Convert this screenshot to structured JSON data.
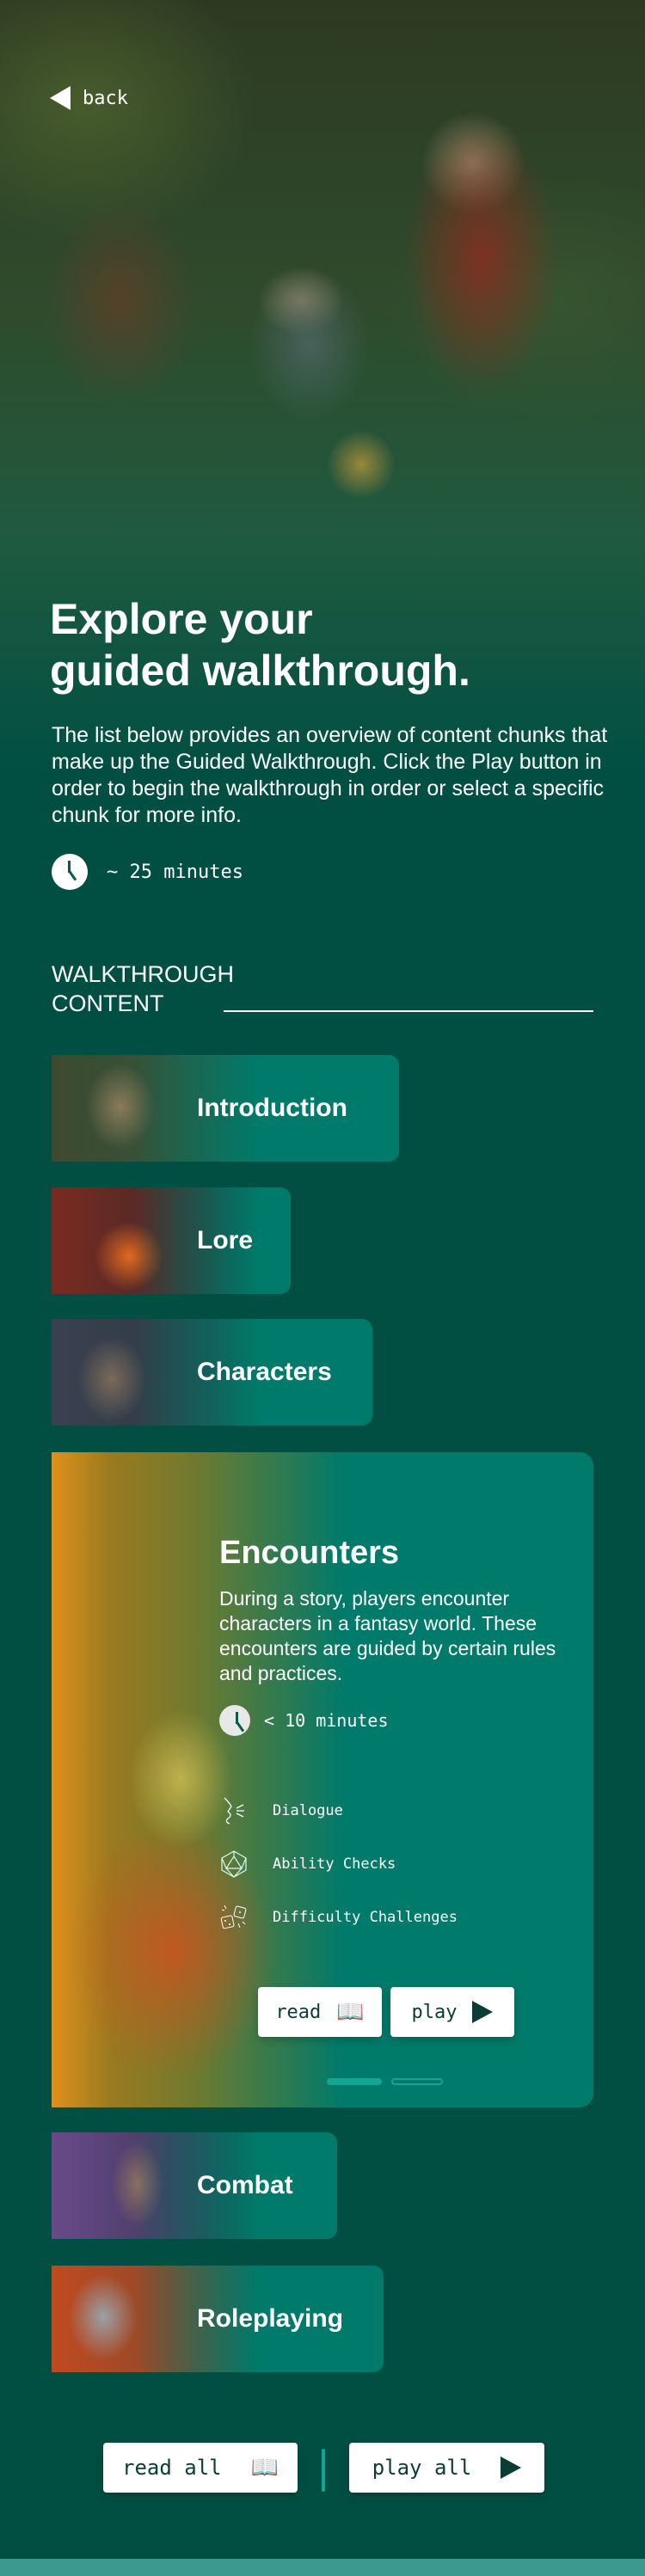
{
  "nav": {
    "back_label": "back"
  },
  "hero": {
    "title_line1": "Explore your",
    "title_line2": "guided walkthrough.",
    "description": "The list below provides an overview of content chunks that make up the Guided Walkthrough. Click the Play button in order to begin the walkthrough in order or select a specific chunk for more info.",
    "duration": "~ 25 minutes"
  },
  "section": {
    "title_line1": "WALKTHROUGH",
    "title_line2": "CONTENT"
  },
  "chunks": [
    {
      "label": "Introduction"
    },
    {
      "label": "Lore"
    },
    {
      "label": "Characters"
    },
    {
      "label": "Encounters",
      "description": "During a story, players encounter characters in a fantasy world. These encounters are guided by certain rules and practices.",
      "duration": "< 10 minutes",
      "features": [
        {
          "label": "Dialogue",
          "icon": "dialogue-icon"
        },
        {
          "label": "Ability Checks",
          "icon": "d20-icon"
        },
        {
          "label": "Difficulty Challenges",
          "icon": "dice-icon"
        }
      ],
      "read_label": "read",
      "play_label": "play",
      "page_count": 2,
      "current_page": 1
    },
    {
      "label": "Combat"
    },
    {
      "label": "Roleplaying"
    }
  ],
  "footer": {
    "read_all_label": "read all",
    "play_all_label": "play all"
  },
  "colors": {
    "background": "#004f42",
    "card": "#007a6a",
    "accent": "#12a593"
  }
}
